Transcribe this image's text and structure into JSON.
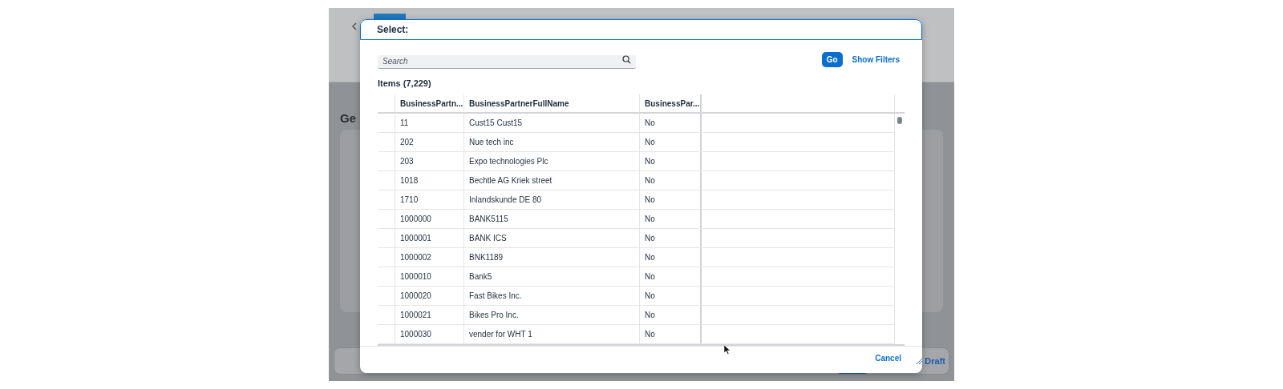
{
  "background": {
    "heading": "Ge",
    "draft_label": "Draft"
  },
  "dialog": {
    "title": "Select:",
    "search": {
      "placeholder": "Search"
    },
    "go_button": "Go",
    "show_filters": "Show Filters",
    "items_heading": "Items (7,229)",
    "table": {
      "columns": [
        "BusinessPartn...",
        "BusinessPartnerFullName",
        "BusinessPar..."
      ],
      "rows": [
        {
          "cells": [
            "11",
            "Cust15 Cust15",
            "No"
          ]
        },
        {
          "cells": [
            "202",
            "Nue tech inc",
            "No"
          ]
        },
        {
          "cells": [
            "203",
            "Expo technologies Plc",
            "No"
          ]
        },
        {
          "cells": [
            "1018",
            "Bechtle AG Kriek street",
            "No"
          ]
        },
        {
          "cells": [
            "1710",
            "Inlandskunde DE 80",
            "No"
          ]
        },
        {
          "cells": [
            "1000000",
            "BANK5115",
            "No"
          ]
        },
        {
          "cells": [
            "1000001",
            "BANK ICS",
            "No"
          ]
        },
        {
          "cells": [
            "1000002",
            "BNK1189",
            "No"
          ]
        },
        {
          "cells": [
            "1000010",
            "Bank5",
            "No"
          ]
        },
        {
          "cells": [
            "1000020",
            "Fast Bikes Inc.",
            "No"
          ]
        },
        {
          "cells": [
            "1000021",
            "Bikes Pro Inc.",
            "No"
          ]
        },
        {
          "cells": [
            "1000030",
            "vender for WHT 1",
            "No"
          ]
        }
      ]
    },
    "cancel_button": "Cancel"
  }
}
